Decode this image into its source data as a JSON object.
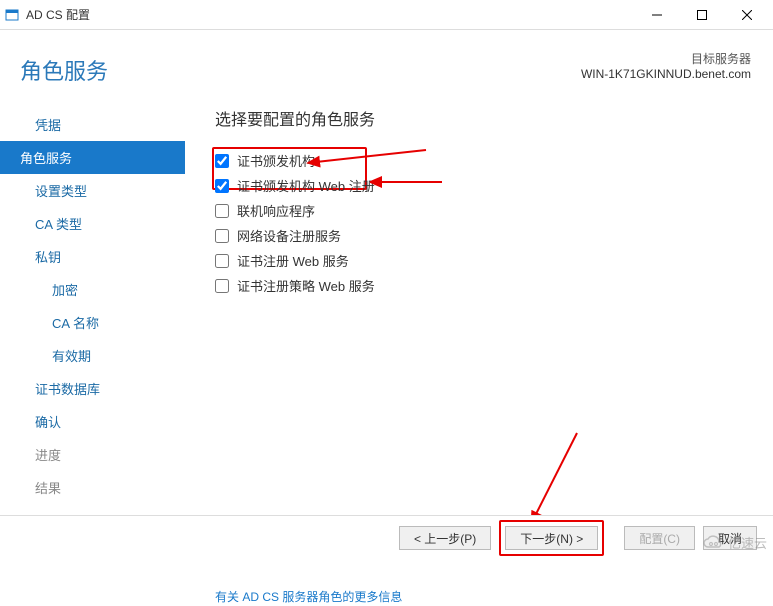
{
  "window": {
    "title": "AD CS 配置"
  },
  "header": {
    "page_title": "角色服务",
    "target_label": "目标服务器",
    "target_server": "WIN-1K71GKINNUD.benet.com"
  },
  "sidebar": {
    "items": [
      {
        "label": "凭据",
        "active": false
      },
      {
        "label": "角色服务",
        "active": true
      },
      {
        "label": "设置类型",
        "active": false
      },
      {
        "label": "CA 类型",
        "active": false
      },
      {
        "label": "私钥",
        "active": false
      },
      {
        "label": "加密",
        "active": false,
        "sub": true
      },
      {
        "label": "CA 名称",
        "active": false,
        "sub": true
      },
      {
        "label": "有效期",
        "active": false,
        "sub": true
      },
      {
        "label": "证书数据库",
        "active": false
      },
      {
        "label": "确认",
        "active": false
      },
      {
        "label": "进度",
        "active": false,
        "disabled": true
      },
      {
        "label": "结果",
        "active": false,
        "disabled": true
      }
    ]
  },
  "main": {
    "heading": "选择要配置的角色服务",
    "roles": [
      {
        "label": "证书颁发机构",
        "checked": true
      },
      {
        "label": "证书颁发机构 Web 注册",
        "checked": true
      },
      {
        "label": "联机响应程序",
        "checked": false
      },
      {
        "label": "网络设备注册服务",
        "checked": false
      },
      {
        "label": "证书注册 Web 服务",
        "checked": false
      },
      {
        "label": "证书注册策略 Web 服务",
        "checked": false
      }
    ],
    "more_info": "有关 AD CS 服务器角色的更多信息"
  },
  "buttons": {
    "prev": "< 上一步(P)",
    "next": "下一步(N) >",
    "configure": "配置(C)",
    "cancel": "取消"
  },
  "watermark": {
    "text": "亿速云"
  }
}
